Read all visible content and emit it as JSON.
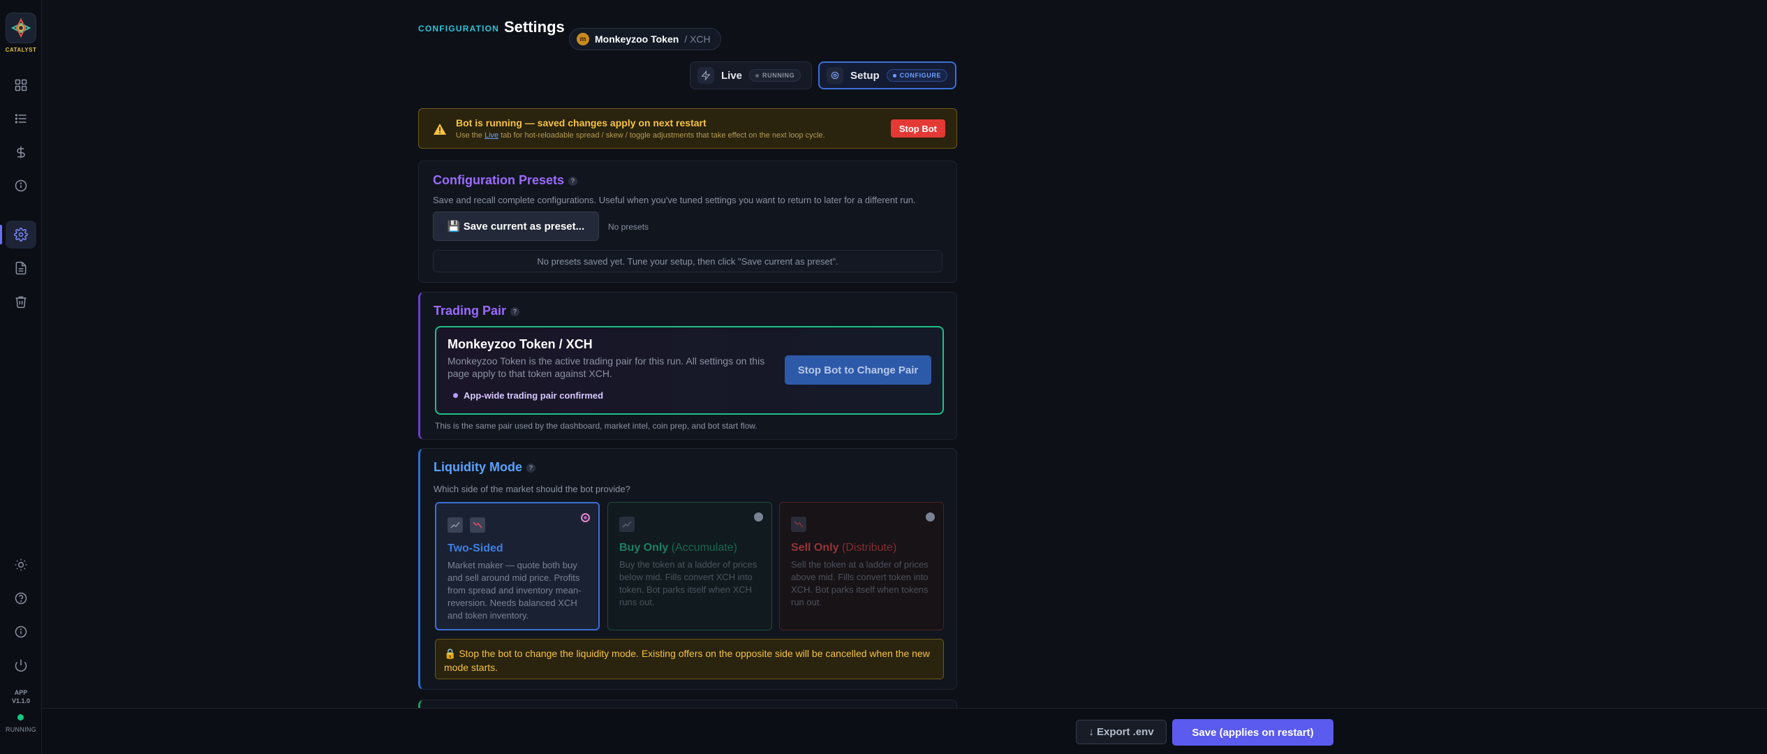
{
  "sidebar": {
    "logo_text": "CATALYST",
    "version_line1": "APP",
    "version_line2": "V1.1.0",
    "status": "RUNNING"
  },
  "header": {
    "eyebrow": "CONFIGURATION",
    "title": "Settings",
    "pair_coin_letter": "m",
    "pair_name": "Monkeyzoo Token",
    "pair_quote": "/ XCH"
  },
  "tabs": {
    "live_label": "Live",
    "live_status": "RUNNING",
    "setup_label": "Setup",
    "setup_status": "CONFIGURE"
  },
  "warning": {
    "title": "Bot is running — saved changes apply on next restart",
    "sub_prefix": "Use the ",
    "sub_link": "Live",
    "sub_suffix": " tab for hot-reloadable spread / skew / toggle adjustments that take effect on the next loop cycle.",
    "stop_button": "Stop Bot"
  },
  "presets": {
    "title": "Configuration Presets",
    "help": "?",
    "description": "Save and recall complete configurations. Useful when you've tuned settings you want to return to later for a different run.",
    "save_button": "💾 Save current as preset...",
    "count_label": "No presets",
    "empty_text": "No presets saved yet. Tune your setup, then click \"Save current as preset\"."
  },
  "trading_pair": {
    "title": "Trading Pair",
    "help": "?",
    "pair_title": "Monkeyzoo Token / XCH",
    "pair_desc": "Monkeyzoo Token is the active trading pair for this run. All settings on this page apply to that token against XCH.",
    "confirm": "App-wide trading pair confirmed",
    "change_button": "Stop Bot to Change Pair",
    "note": "This is the same pair used by the dashboard, market intel, coin prep, and bot start flow."
  },
  "liquidity": {
    "title": "Liquidity Mode",
    "help": "?",
    "description": "Which side of the market should the bot provide?",
    "modes": [
      {
        "title": "Two-Sided",
        "suffix": "",
        "desc": "Market maker — quote both buy and sell around mid price. Profits from spread and inventory mean-reversion. Needs balanced XCH and token inventory.",
        "selected": true,
        "color": "#3d7fe0"
      },
      {
        "title": "Buy Only",
        "suffix": " (Accumulate)",
        "desc": "Buy the token at a ladder of prices below mid. Fills convert XCH into token. Bot parks itself when XCH runs out.",
        "selected": false,
        "color": "#2bd39a"
      },
      {
        "title": "Sell Only",
        "suffix": " (Distribute)",
        "desc": "Sell the token at a ladder of prices above mid. Fills convert token into XCH. Bot parks itself when tokens run out.",
        "selected": false,
        "color": "#ff5252"
      }
    ],
    "lock_note": "🔒 Stop the bot to change the liquidity mode. Existing offers on the opposite side will be cancelled when the new mode starts."
  },
  "footer": {
    "export_button": "↓ Export .env",
    "save_button": "Save (applies on restart)"
  },
  "colors": {
    "accent": "#5b5bf0",
    "eyebrow": "#26c6da",
    "warning": "#f6c343",
    "danger": "#e53935",
    "success": "#1fbf87"
  }
}
